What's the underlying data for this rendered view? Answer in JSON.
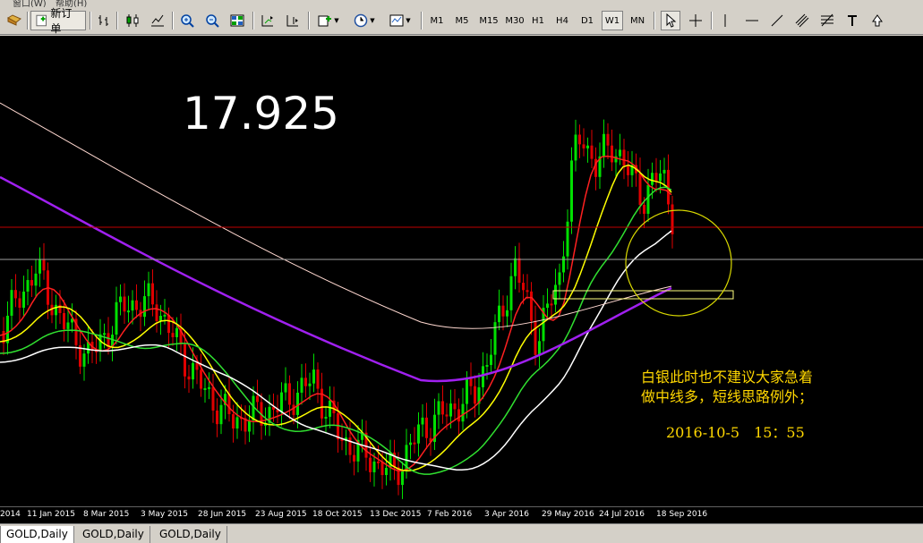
{
  "menu": {
    "window": "窗口(W)",
    "help": "帮助(H)"
  },
  "toolbar": {
    "new_order": "新订单",
    "timeframes": [
      "M1",
      "M5",
      "M15",
      "M30",
      "H1",
      "H4",
      "D1",
      "W1",
      "MN"
    ],
    "active_timeframe": "W1"
  },
  "chart": {
    "big_price": "17.925",
    "comment_line1": "白银此时也不建议大家急着",
    "comment_line2": "做中线多，短线思路例外；",
    "comment_time": "2016-10-5　15：55",
    "xaxis_labels": [
      "2014",
      "11 Jan 2015",
      "8 Mar 2015",
      "3 May 2015",
      "28 Jun 2015",
      "23 Aug 2015",
      "18 Oct 2015",
      "13 Dec 2015",
      "7 Feb 2016",
      "3 Apr 2016",
      "29 May 2016",
      "24 Jul 2016",
      "18 Sep 2016"
    ],
    "colors": {
      "bull": "#00e000",
      "bear": "#e00000",
      "ma_red": "#ff2020",
      "ma_yellow": "#ffff00",
      "ma_green": "#30e030",
      "ma_white": "#ffffff",
      "ma_purple": "#a020f0",
      "ma_pink": "#ffd8d0",
      "hline_red": "#c00000",
      "hline_gray": "#a0a0a0",
      "circle": "#d8d800"
    }
  },
  "tabs": [
    "GOLD,Daily",
    "GOLD,Daily",
    "GOLD,Daily"
  ]
}
